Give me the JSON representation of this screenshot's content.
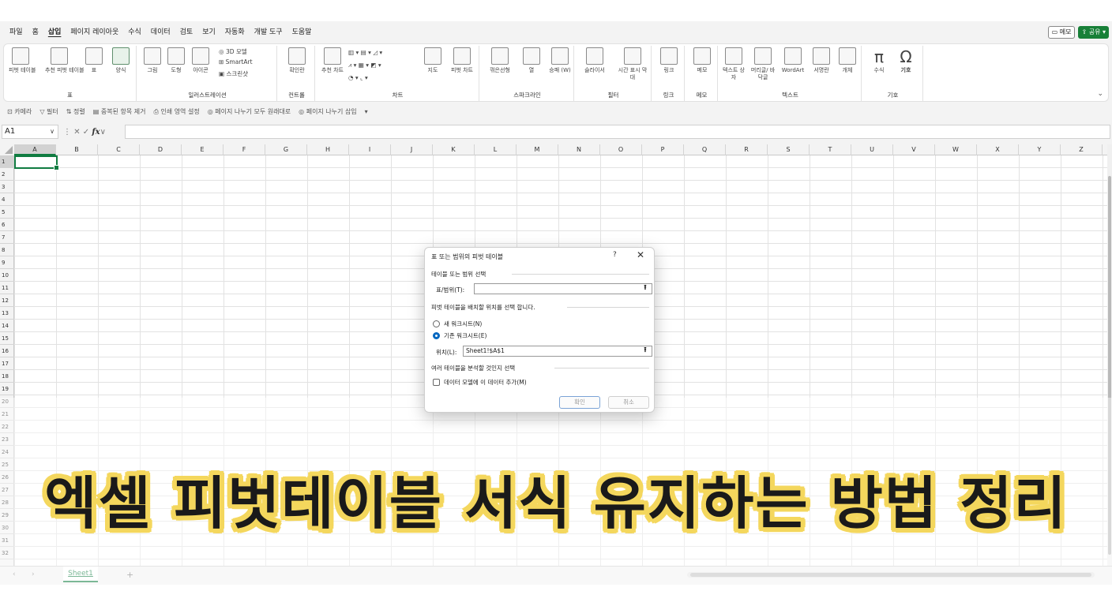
{
  "menu": [
    "파일",
    "홈",
    "삽입",
    "페이지 레이아웃",
    "수식",
    "데이터",
    "검토",
    "보기",
    "자동화",
    "개발 도구",
    "도움말"
  ],
  "menu_active": "삽입",
  "topright": {
    "memo": "메모",
    "share": "공유"
  },
  "ribbon": {
    "groups": [
      "표",
      "일러스트레이션",
      "컨트롤",
      "차트",
      "스파크라인",
      "필터",
      "링크",
      "메모",
      "텍스트",
      "기호"
    ],
    "buttons": {
      "pivot": "피벗 테이블",
      "rec_pivot": "추천 피벗 테이블",
      "table": "표",
      "forms": "양식",
      "picture": "그림",
      "shapes": "도형",
      "icons": "아이콘",
      "model3d": "3D 모델",
      "smartart": "SmartArt",
      "screenshot": "스크린샷",
      "checkbox": "확인란",
      "rec_charts": "추천 차트",
      "maps": "지도",
      "pivot_chart": "피벗 차트",
      "line": "꺾은선형",
      "column": "열",
      "winloss": "승패 (W)",
      "slicer": "슬라이서",
      "timeline": "시간 표시 막대",
      "link": "링크",
      "comment": "메모",
      "textbox": "텍스트 상자",
      "header": "머리글/ 바닥글",
      "wordart": "WordArt",
      "signature": "서명란",
      "object": "개체",
      "equation": "수식",
      "symbol": "기호"
    }
  },
  "quickbar": [
    "카메라",
    "필터",
    "정렬",
    "중복된 항목 제거",
    "인쇄 영역 설정",
    "페이지 나누기 모두 원래대로",
    "페이지 나누기 삽입"
  ],
  "namebox": "A1",
  "fx": "fx",
  "columns": [
    "A",
    "B",
    "C",
    "D",
    "E",
    "F",
    "G",
    "H",
    "I",
    "J",
    "K",
    "L",
    "M",
    "N",
    "O",
    "P",
    "Q",
    "R",
    "S",
    "T",
    "U",
    "V",
    "W",
    "X",
    "Y",
    "Z"
  ],
  "rows": [
    "1",
    "2",
    "3",
    "4",
    "5",
    "6",
    "7",
    "8",
    "9",
    "10",
    "11",
    "12",
    "13",
    "14",
    "15",
    "16",
    "17",
    "18",
    "19",
    "20",
    "21",
    "22",
    "23",
    "24",
    "25",
    "26",
    "27",
    "28",
    "29",
    "30",
    "31",
    "32"
  ],
  "sheet_tab": "Sheet1",
  "dialog": {
    "title": "표 또는 범위의 피벗 테이블",
    "help": "?",
    "close": "✕",
    "section1": "테이블 또는 범위 선택",
    "range_label": "표/범위(T):",
    "range_value": "",
    "section2": "피벗 테이블을 배치할 위치를 선택 합니다.",
    "radio_new": "새 워크시트(N)",
    "radio_existing": "기존 워크시트(E)",
    "location_label": "위치(L):",
    "location_value": "Sheet1!$A$1",
    "section3": "여러 테이블을 분석할 것인지 선택",
    "checkbox_label": "데이터 모델에 이 데이터 추가(M)",
    "ok": "확인",
    "cancel": "취소"
  },
  "caption": "엑셀 피벗테이블 서식 유지하는 방법 정리",
  "colors": {
    "accent": "#107c41",
    "caption_outline": "#f4d75d",
    "radio": "#0067c0"
  }
}
